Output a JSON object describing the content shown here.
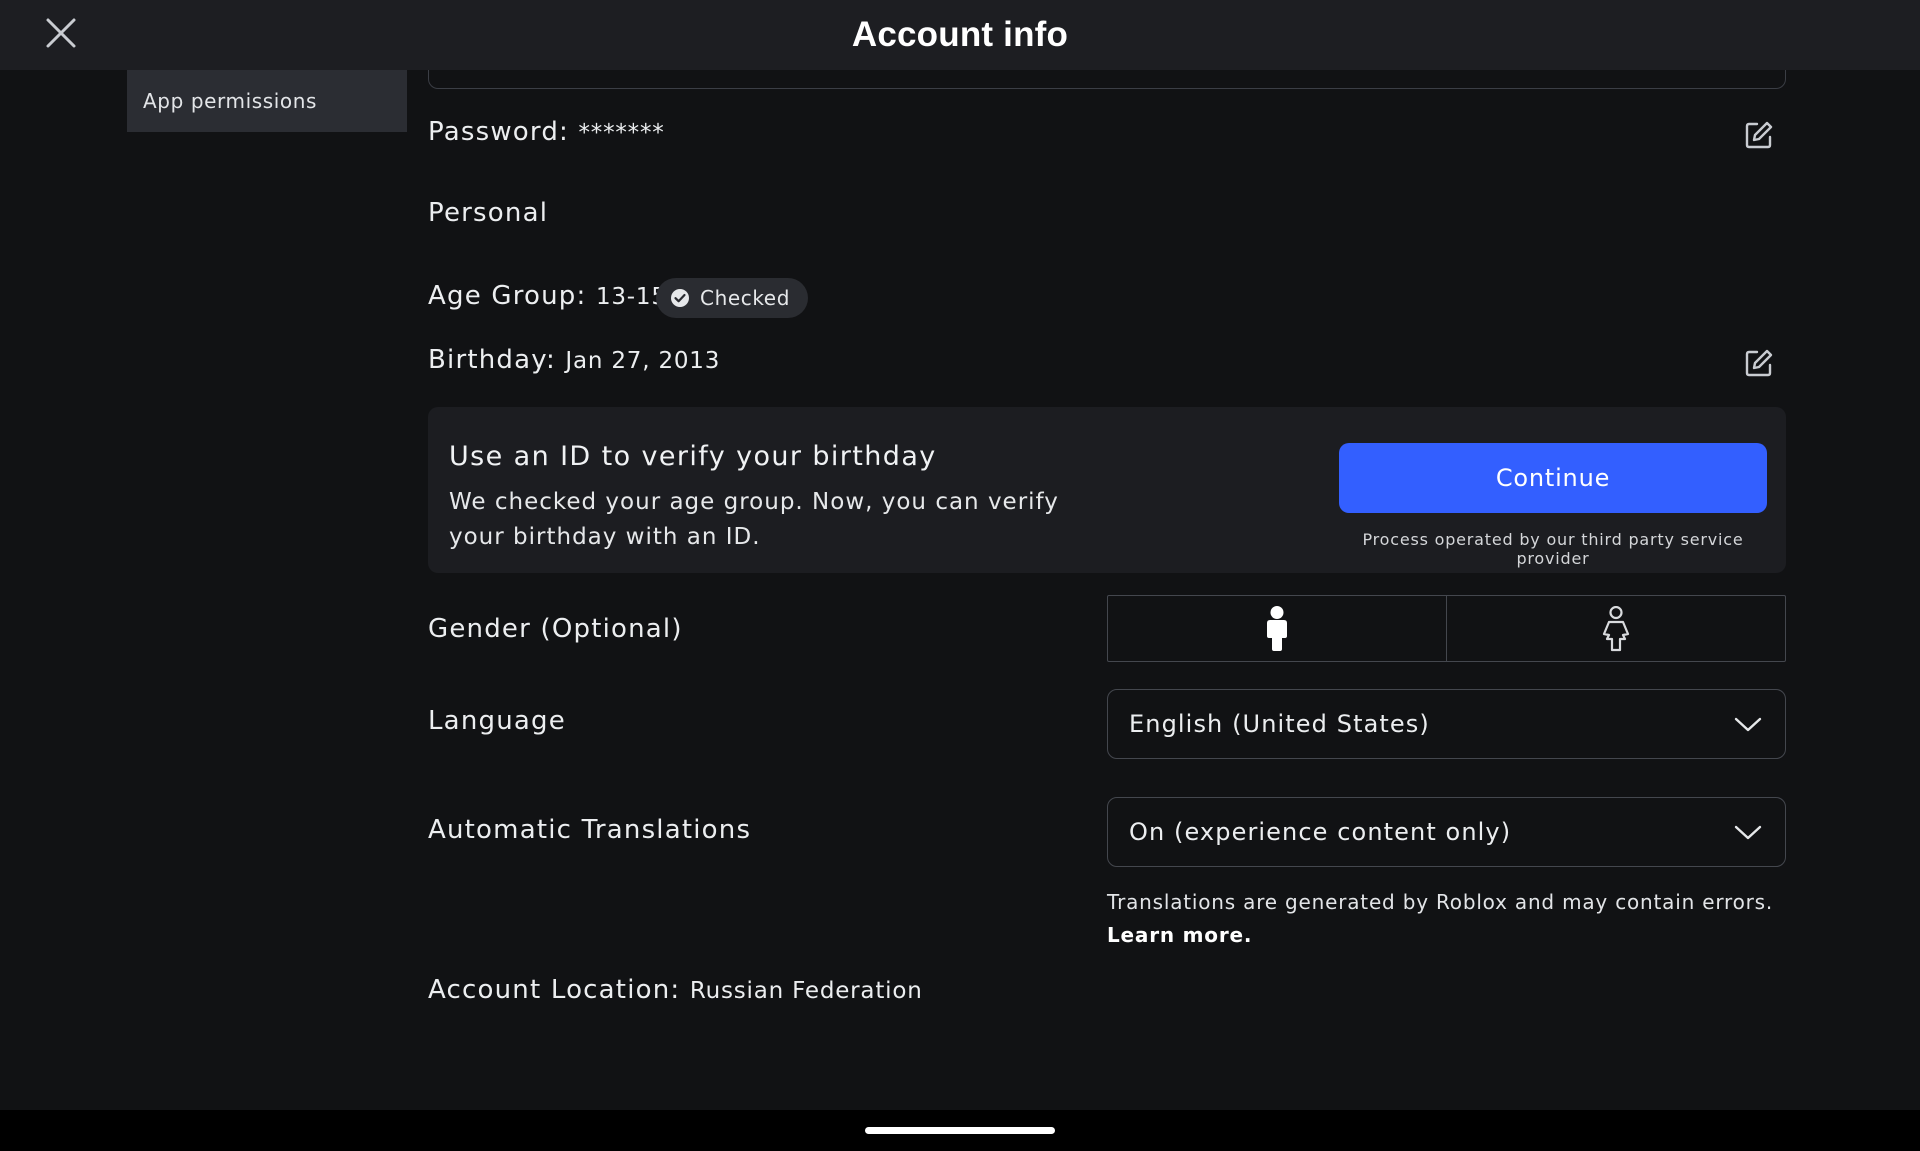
{
  "header": {
    "title": "Account info"
  },
  "sidebar": {
    "items": [
      {
        "label": "App permissions"
      }
    ]
  },
  "account": {
    "password_label": "Password:",
    "password_value": "*******"
  },
  "personal": {
    "section_title": "Personal",
    "age_group_label": "Age Group:",
    "age_group_value": "13-15",
    "age_status_badge": "Checked",
    "birthday_label": "Birthday:",
    "birthday_value": "Jan 27, 2013"
  },
  "verify_card": {
    "title": "Use an ID to verify your birthday",
    "description": "We checked your age group. Now, you can verify your birthday with an ID.",
    "button_label": "Continue",
    "provider_note": "Process operated by our third party service provider"
  },
  "gender": {
    "label": "Gender (Optional)",
    "options": [
      "male-icon",
      "female-icon"
    ]
  },
  "language": {
    "label": "Language",
    "selected": "English (United States)"
  },
  "translations": {
    "label": "Automatic Translations",
    "selected": "On (experience content only)",
    "note": "Translations are generated by Roblox and may contain errors. ",
    "learn_more": "Learn more."
  },
  "location": {
    "label": "Account Location:",
    "value": "Russian Federation"
  },
  "colors": {
    "background": "#111214",
    "header": "#1d1e22",
    "accent_button": "#335fff",
    "card": "#1c1d21"
  }
}
